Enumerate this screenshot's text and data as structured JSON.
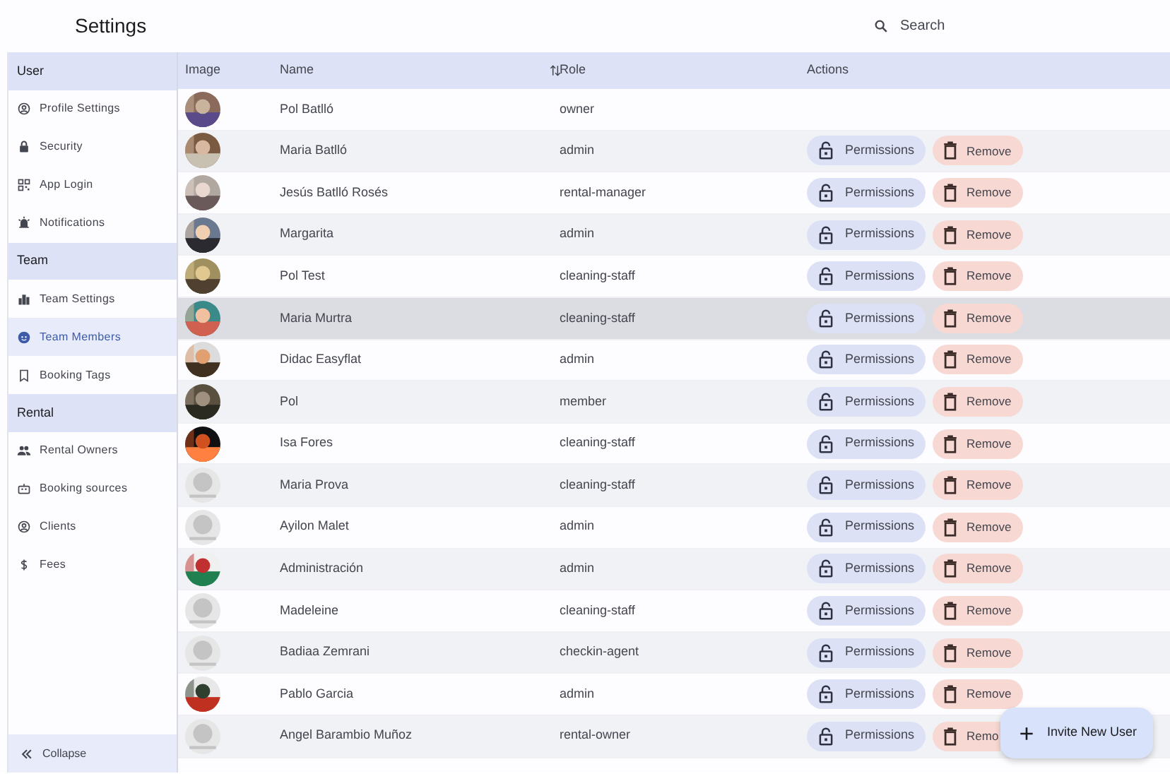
{
  "header": {
    "title": "Settings",
    "search": {
      "placeholder": "Search"
    }
  },
  "sidebar": {
    "sections": [
      {
        "title": "User",
        "items": [
          {
            "label": "Profile Settings",
            "selected": false
          },
          {
            "label": "Security",
            "selected": false
          },
          {
            "label": "App Login",
            "selected": false
          },
          {
            "label": "Notifications",
            "selected": false
          }
        ]
      },
      {
        "title": "Team",
        "items": [
          {
            "label": "Team Settings",
            "selected": false
          },
          {
            "label": "Team Members",
            "selected": true
          },
          {
            "label": "Booking Tags",
            "selected": false
          }
        ]
      },
      {
        "title": "Rental",
        "items": [
          {
            "label": "Rental Owners",
            "selected": false
          },
          {
            "label": "Booking sources",
            "selected": false
          },
          {
            "label": "Clients",
            "selected": false
          },
          {
            "label": "Fees",
            "selected": false
          }
        ]
      }
    ],
    "collapse": {
      "label": "Collapse"
    }
  },
  "table": {
    "columns": [
      "Image",
      "Name",
      "Role",
      "Actions"
    ],
    "rows": [
      {
        "avatar": {
          "kind": "picture"
        },
        "name": "Pol Batlló",
        "role": "owner",
        "highlighted": false,
        "actions": []
      },
      {
        "avatar": {
          "kind": "picture"
        },
        "name": "Maria Batlló",
        "role": "admin",
        "highlighted": false,
        "actions": [
          "Permissions",
          "Remove"
        ]
      },
      {
        "avatar": {
          "kind": "picture"
        },
        "name": "Jesús Batlló Rosés",
        "role": "rental-manager",
        "highlighted": false,
        "actions": [
          "Permissions",
          "Remove"
        ]
      },
      {
        "avatar": {
          "kind": "picture"
        },
        "name": "Margarita",
        "role": "admin",
        "highlighted": false,
        "actions": [
          "Permissions",
          "Remove"
        ]
      },
      {
        "avatar": {
          "kind": "picture"
        },
        "name": "Pol Test",
        "role": "cleaning-staff",
        "highlighted": false,
        "actions": [
          "Permissions",
          "Remove"
        ]
      },
      {
        "avatar": {
          "kind": "picture"
        },
        "name": "Maria Murtra",
        "role": "cleaning-staff",
        "highlighted": true,
        "actions": [
          "Permissions",
          "Remove"
        ]
      },
      {
        "avatar": {
          "kind": "picture"
        },
        "name": "Didac Easyflat",
        "role": "admin",
        "highlighted": false,
        "actions": [
          "Permissions",
          "Remove"
        ]
      },
      {
        "avatar": {
          "kind": "picture"
        },
        "name": "Pol",
        "role": "member",
        "highlighted": false,
        "actions": [
          "Permissions",
          "Remove"
        ]
      },
      {
        "avatar": {
          "kind": "picture"
        },
        "name": "Isa Fores",
        "role": "cleaning-staff",
        "highlighted": false,
        "actions": [
          "Permissions",
          "Remove"
        ]
      },
      {
        "avatar": {
          "kind": "placeholder"
        },
        "name": "Maria Prova",
        "role": "cleaning-staff",
        "highlighted": false,
        "actions": [
          "Permissions",
          "Remove"
        ]
      },
      {
        "avatar": {
          "kind": "placeholder"
        },
        "name": "Ayilon Malet",
        "role": "admin",
        "highlighted": false,
        "actions": [
          "Permissions",
          "Remove"
        ]
      },
      {
        "avatar": {
          "kind": "picture"
        },
        "name": "Administración",
        "role": "admin",
        "highlighted": false,
        "actions": [
          "Permissions",
          "Remove"
        ]
      },
      {
        "avatar": {
          "kind": "placeholder"
        },
        "name": "Madeleine",
        "role": "cleaning-staff",
        "highlighted": false,
        "actions": [
          "Permissions",
          "Remove"
        ]
      },
      {
        "avatar": {
          "kind": "placeholder"
        },
        "name": "Badiaa Zemrani",
        "role": "checkin-agent",
        "highlighted": false,
        "actions": [
          "Permissions",
          "Remove"
        ]
      },
      {
        "avatar": {
          "kind": "picture"
        },
        "name": "Pablo Garcia",
        "role": "admin",
        "highlighted": false,
        "actions": [
          "Permissions",
          "Remove"
        ]
      },
      {
        "avatar": {
          "kind": "placeholder"
        },
        "name": "Angel Barambio Muñoz",
        "role": "rental-owner",
        "highlighted": false,
        "actions": [
          "Permissions",
          "Remo"
        ]
      }
    ]
  },
  "fab": {
    "label": "Invite New User"
  }
}
